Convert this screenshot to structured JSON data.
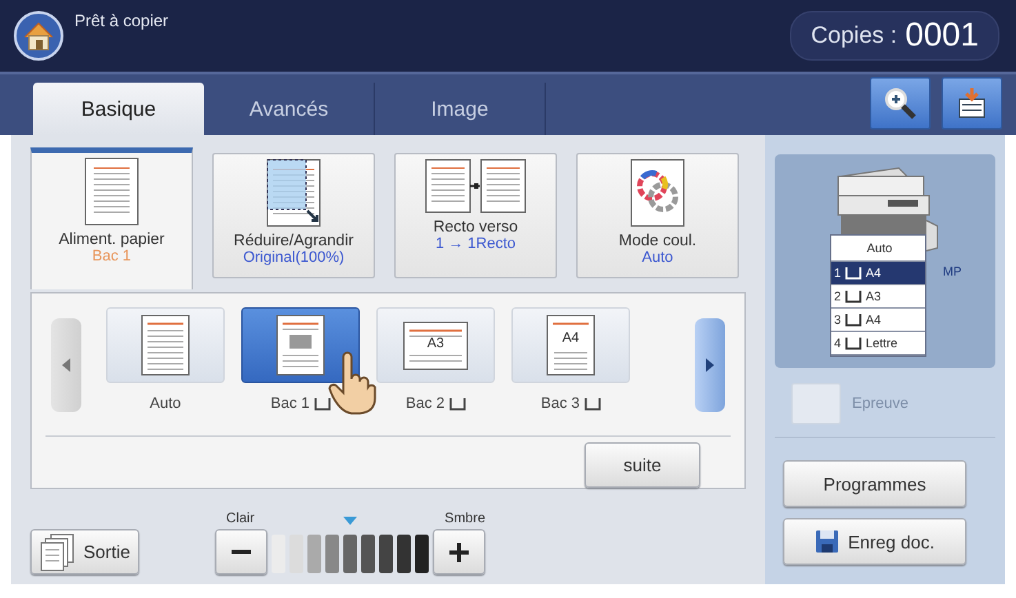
{
  "header": {
    "status": "Prêt à copier",
    "copies_label": "Copies :",
    "copies_value": "0001"
  },
  "tabs": [
    {
      "label": "Basique",
      "selected": true
    },
    {
      "label": "Avancés",
      "selected": false
    },
    {
      "label": "Image",
      "selected": false
    }
  ],
  "functions": [
    {
      "kind": "paper",
      "title": "Aliment. papier",
      "value": "Bac 1",
      "selected": true
    },
    {
      "kind": "reduce",
      "title": "Réduire/Agrandir",
      "value": "Original(100%)",
      "selected": false
    },
    {
      "kind": "duplex",
      "title": "Recto verso",
      "value": "1 → 1Recto",
      "selected": false
    },
    {
      "kind": "color",
      "title": "Mode coul.",
      "value": "Auto",
      "selected": false
    }
  ],
  "tray_options": [
    {
      "kind": "portrait",
      "label": "Auto",
      "tray_icon": false,
      "selected": false
    },
    {
      "kind": "portrait-marked",
      "label": "Bac 1",
      "tray_icon": true,
      "selected": true
    },
    {
      "kind": "landscape",
      "paper_label": "A3",
      "label": "Bac 2",
      "tray_icon": true,
      "selected": false
    },
    {
      "kind": "portrait",
      "paper_label": "A4",
      "label": "Bac 3",
      "tray_icon": true,
      "selected": false
    }
  ],
  "more_button": "suite",
  "output_button": "Sortie",
  "density": {
    "light_label": "Clair",
    "dark_label": "Smbre",
    "level": 0.5
  },
  "machine": {
    "bypass_label": "MP",
    "trays": [
      {
        "kind": "auto",
        "label": "Auto",
        "selected": false
      },
      {
        "kind": "tray",
        "number": "1",
        "size": "A4",
        "selected": true
      },
      {
        "kind": "tray",
        "number": "2",
        "size": "A3",
        "selected": false
      },
      {
        "kind": "tray",
        "number": "3",
        "size": "A4",
        "selected": false
      },
      {
        "kind": "tray",
        "number": "4",
        "size": "Lettre",
        "selected": false
      }
    ]
  },
  "proof": {
    "label": "Epreuve",
    "checked": false,
    "disabled": true
  },
  "programs_button": "Programmes",
  "save_button": "Enreg doc."
}
